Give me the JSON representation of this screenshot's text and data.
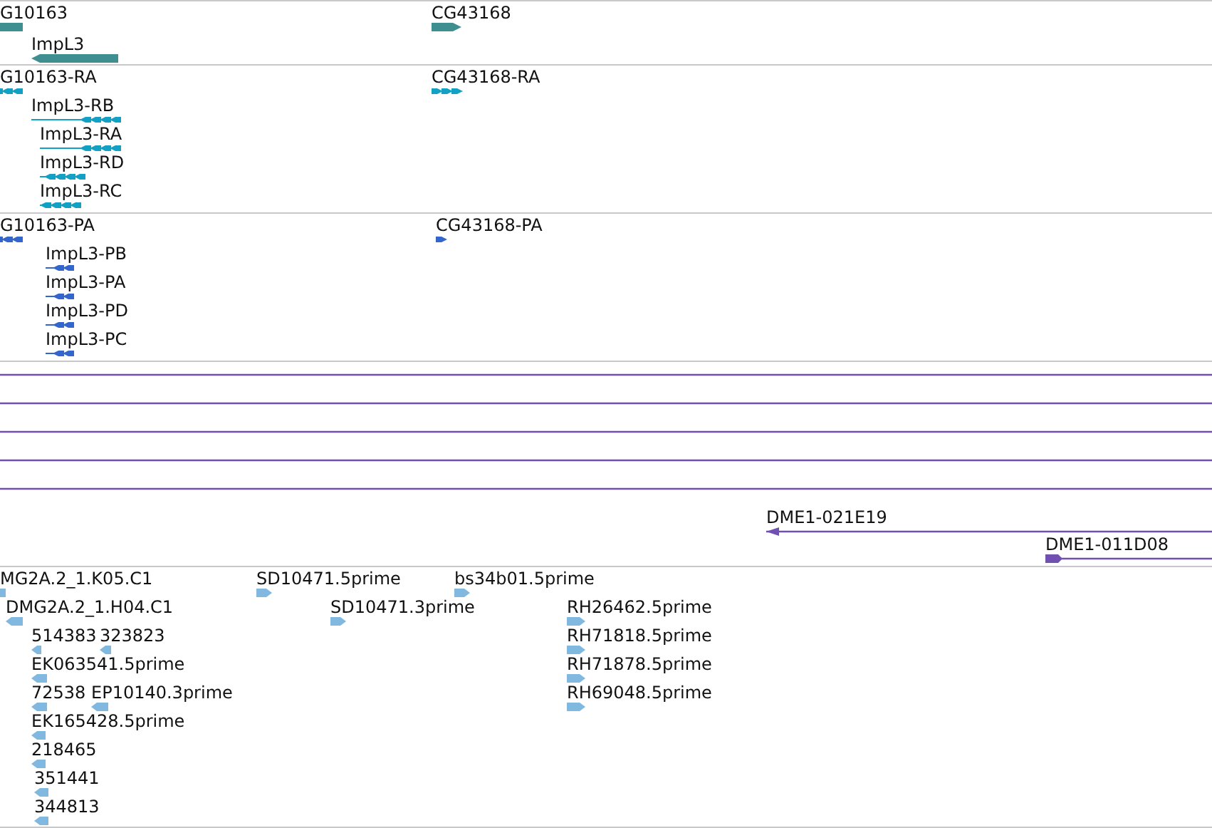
{
  "tracks": [
    {
      "kind": "gene",
      "color": "#3f8f90",
      "features": [
        {
          "label": "G10163",
          "reverse": true
        },
        {
          "label": "ImpL3",
          "reverse": true
        },
        {
          "label": "CG43168",
          "reverse": false
        }
      ]
    },
    {
      "kind": "transcript",
      "color": "#12a0c4",
      "features": [
        {
          "label": "G10163-RA",
          "reverse": true
        },
        {
          "label": "ImpL3-RB",
          "reverse": true
        },
        {
          "label": "ImpL3-RA",
          "reverse": true
        },
        {
          "label": "ImpL3-RD",
          "reverse": true
        },
        {
          "label": "ImpL3-RC",
          "reverse": true
        },
        {
          "label": "CG43168-RA",
          "reverse": false
        }
      ]
    },
    {
      "kind": "protein",
      "color": "#3366cc",
      "features": [
        {
          "label": "G10163-PA",
          "reverse": true
        },
        {
          "label": "ImpL3-PB",
          "reverse": true
        },
        {
          "label": "ImpL3-PA",
          "reverse": true
        },
        {
          "label": "ImpL3-PD",
          "reverse": true
        },
        {
          "label": "ImpL3-PC",
          "reverse": true
        },
        {
          "label": "CG43168-PA",
          "reverse": false
        }
      ]
    },
    {
      "kind": "clone",
      "color": "#7050b0",
      "features": [
        {
          "arrowhead": false
        },
        {
          "arrowhead": false
        },
        {
          "arrowhead": false
        },
        {
          "arrowhead": false
        },
        {
          "arrowhead": false
        },
        {
          "label": "DME1-021E19",
          "arrowhead": true,
          "reverse": true
        },
        {
          "label": "DME1-011D08",
          "arrowhead": true,
          "reverse": false
        }
      ]
    },
    {
      "kind": "est",
      "color": "#80b8e0",
      "features": [
        {
          "label": "MG2A.2_1.K05.C1",
          "reverse": true
        },
        {
          "label": "DMG2A.2_1.H04.C1",
          "reverse": true
        },
        {
          "label": "514383",
          "reverse": true
        },
        {
          "label": "323823",
          "reverse": true
        },
        {
          "label": "EK063541.5prime",
          "reverse": true
        },
        {
          "label": "72538",
          "reverse": true
        },
        {
          "label": "EP10140.3prime",
          "reverse": true
        },
        {
          "label": "EK165428.5prime",
          "reverse": true
        },
        {
          "label": "218465",
          "reverse": true
        },
        {
          "label": "351441",
          "reverse": true
        },
        {
          "label": "344813",
          "reverse": true
        },
        {
          "label": "SD10471.5prime",
          "reverse": false
        },
        {
          "label": "SD10471.3prime",
          "reverse": false
        },
        {
          "label": "bs34b01.5prime",
          "reverse": false
        },
        {
          "label": "RH26462.5prime",
          "reverse": false
        },
        {
          "label": "RH71818.5prime",
          "reverse": false
        },
        {
          "label": "RH71878.5prime",
          "reverse": false
        },
        {
          "label": "RH69048.5prime",
          "reverse": false
        }
      ]
    }
  ]
}
